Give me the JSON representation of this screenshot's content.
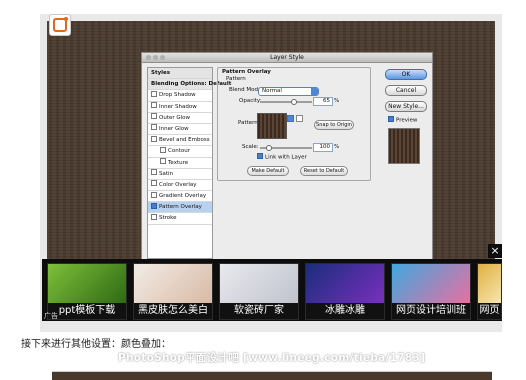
{
  "dialog": {
    "title": "Layer Style",
    "sidebar": [
      {
        "label": "Styles",
        "kind": "head"
      },
      {
        "label": "Blending Options: Default",
        "kind": "head"
      },
      {
        "label": "Drop Shadow",
        "checked": false
      },
      {
        "label": "Inner Shadow",
        "checked": false
      },
      {
        "label": "Outer Glow",
        "checked": false
      },
      {
        "label": "Inner Glow",
        "checked": false
      },
      {
        "label": "Bevel and Emboss",
        "checked": false
      },
      {
        "label": "Contour",
        "checked": false,
        "indent": true
      },
      {
        "label": "Texture",
        "checked": false,
        "indent": true
      },
      {
        "label": "Satin",
        "checked": false
      },
      {
        "label": "Color Overlay",
        "checked": false
      },
      {
        "label": "Gradient Overlay",
        "checked": false
      },
      {
        "label": "Pattern Overlay",
        "checked": true,
        "selected": true
      },
      {
        "label": "Stroke",
        "checked": false
      }
    ],
    "group_title": "Pattern Overlay",
    "group_sub": "Pattern",
    "blend_mode_label": "Blend Mode:",
    "blend_mode_value": "Normal",
    "opacity_label": "Opacity:",
    "opacity_value": "65",
    "opacity_level": 0.65,
    "percent": "%",
    "pattern_label": "Pattern:",
    "snap_button": "Snap to Origin",
    "scale_label": "Scale:",
    "scale_value": "100",
    "link_label": "Link with Layer",
    "make_default": "Make Default",
    "reset_default": "Reset to Default",
    "ok": "OK",
    "cancel": "Cancel",
    "new_style": "New Style...",
    "preview_label": "Preview"
  },
  "ad_strip": {
    "label": "广告",
    "close": "×",
    "items": [
      {
        "caption": "ppt模板下载",
        "colors": [
          "#7fbf3a",
          "#2e6a14"
        ]
      },
      {
        "caption": "黑皮肤怎么美白",
        "colors": [
          "#f2ece6",
          "#d9b9a4"
        ]
      },
      {
        "caption": "软瓷砖厂家",
        "colors": [
          "#e9e9ee",
          "#bfc3cc"
        ]
      },
      {
        "caption": "冰雕冰雕",
        "colors": [
          "#1a2d7a",
          "#7a2fbf"
        ]
      },
      {
        "caption": "网页设计培训班",
        "colors": [
          "#3fa8e0",
          "#e86fa0"
        ]
      },
      {
        "caption": "网页",
        "colors": [
          "#e0b040",
          "#f6e6b0"
        ]
      }
    ]
  },
  "body_text": "接下来进行其他设置：颜色叠加：",
  "watermark": "PhotoShop平面设计吧 [www.lineeg.com/tieba/1783]"
}
